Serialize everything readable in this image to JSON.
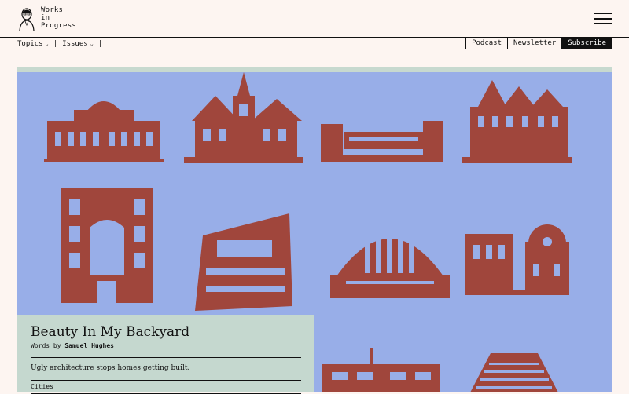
{
  "brand": {
    "line1": "Works",
    "line2": "in",
    "line3": "Progress"
  },
  "nav": {
    "topics": "Topics",
    "issues": "Issues",
    "sep": "|",
    "podcast": "Podcast",
    "newsletter": "Newsletter",
    "subscribe": "Subscribe"
  },
  "article": {
    "title": "Beauty In My Backyard",
    "byline_prefix": "Words by",
    "author": "Samuel Hughes",
    "description": "Ugly architecture stops homes getting built.",
    "tag": "Cities"
  },
  "colors": {
    "background": "#fdf5f1",
    "hero": "#98aee8",
    "card": "#c5d8cf",
    "ink": "#a0463c"
  },
  "icons": [
    "portrait-logo-icon",
    "chevron-down-icon",
    "hamburger-menu-icon"
  ]
}
